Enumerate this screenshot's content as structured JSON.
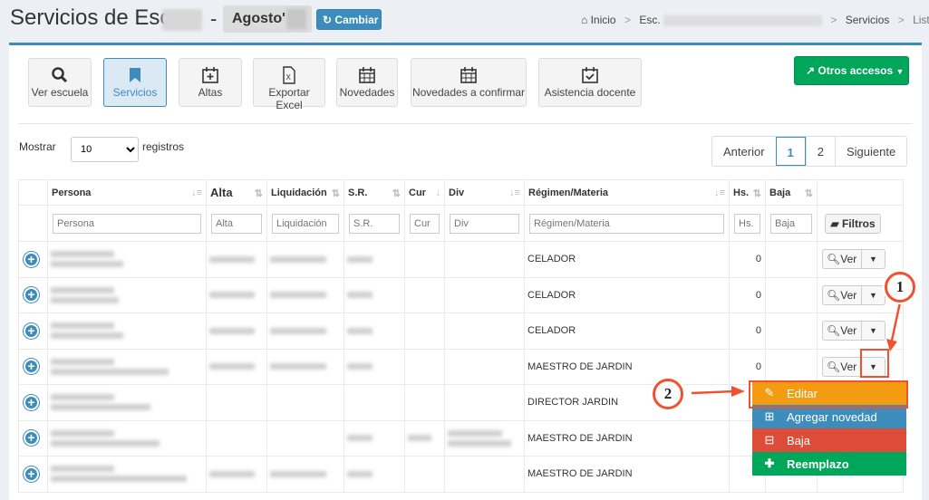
{
  "header": {
    "title": "Servicios de Esc.",
    "dash": "-",
    "month": "Agosto'",
    "cambiar_label": "Cambiar",
    "breadcrumb": {
      "home": "Inicio",
      "school": "Esc.",
      "section": "Servicios",
      "current": "Listar"
    }
  },
  "toolbar": {
    "buttons": [
      {
        "label": "Ver escuela",
        "icon": "search-icon"
      },
      {
        "label": "Servicios",
        "icon": "bookmark-icon",
        "active": true
      },
      {
        "label": "Altas",
        "icon": "calendar-plus-icon"
      },
      {
        "label": "Exportar Excel",
        "icon": "excel-icon"
      },
      {
        "label": "Novedades",
        "icon": "calendar-icon"
      },
      {
        "label": "Novedades a confirmar",
        "icon": "calendar-icon"
      },
      {
        "label": "Asistencia docente",
        "icon": "calendar-check-icon"
      }
    ],
    "otros_accesos": "Otros accesos"
  },
  "length_menu": {
    "prefix": "Mostrar",
    "value": "10",
    "suffix": "registros"
  },
  "pagination": {
    "prev": "Anterior",
    "pages": [
      "1",
      "2"
    ],
    "next": "Siguiente"
  },
  "table": {
    "columns": [
      {
        "label": "Persona",
        "placeholder": "Persona"
      },
      {
        "label": "Alta",
        "placeholder": "Alta"
      },
      {
        "label": "Liquidación",
        "placeholder": "Liquidación"
      },
      {
        "label": "S.R.",
        "placeholder": "S.R."
      },
      {
        "label": "Cur",
        "placeholder": "Cur"
      },
      {
        "label": "Div",
        "placeholder": "Div"
      },
      {
        "label": "Régimen/Materia",
        "placeholder": "Régimen/Materia"
      },
      {
        "label": "Hs.",
        "placeholder": "Hs."
      },
      {
        "label": "Baja",
        "placeholder": "Baja"
      }
    ],
    "filtros_label": "Filtros",
    "ver_label": "Ver",
    "rows": [
      {
        "materia": "CELADOR",
        "hs": "0"
      },
      {
        "materia": "CELADOR",
        "hs": "0"
      },
      {
        "materia": "CELADOR",
        "hs": "0"
      },
      {
        "materia": "MAESTRO DE JARDIN",
        "hs": "0"
      },
      {
        "materia": "DIRECTOR JARDIN",
        "hs": ""
      },
      {
        "materia": "MAESTRO DE JARDIN",
        "hs": ""
      },
      {
        "materia": "MAESTRO DE JARDIN",
        "hs": ""
      }
    ]
  },
  "dropdown": {
    "items": [
      {
        "label": "Editar",
        "icon": "pencil-icon"
      },
      {
        "label": "Agregar novedad",
        "icon": "calendar-plus-icon"
      },
      {
        "label": "Baja",
        "icon": "calendar-minus-icon"
      },
      {
        "label": "Reemplazo",
        "icon": "plus-icon"
      }
    ]
  },
  "annotations": {
    "step1": "1",
    "step2": "2",
    "color": "#f0522f"
  }
}
